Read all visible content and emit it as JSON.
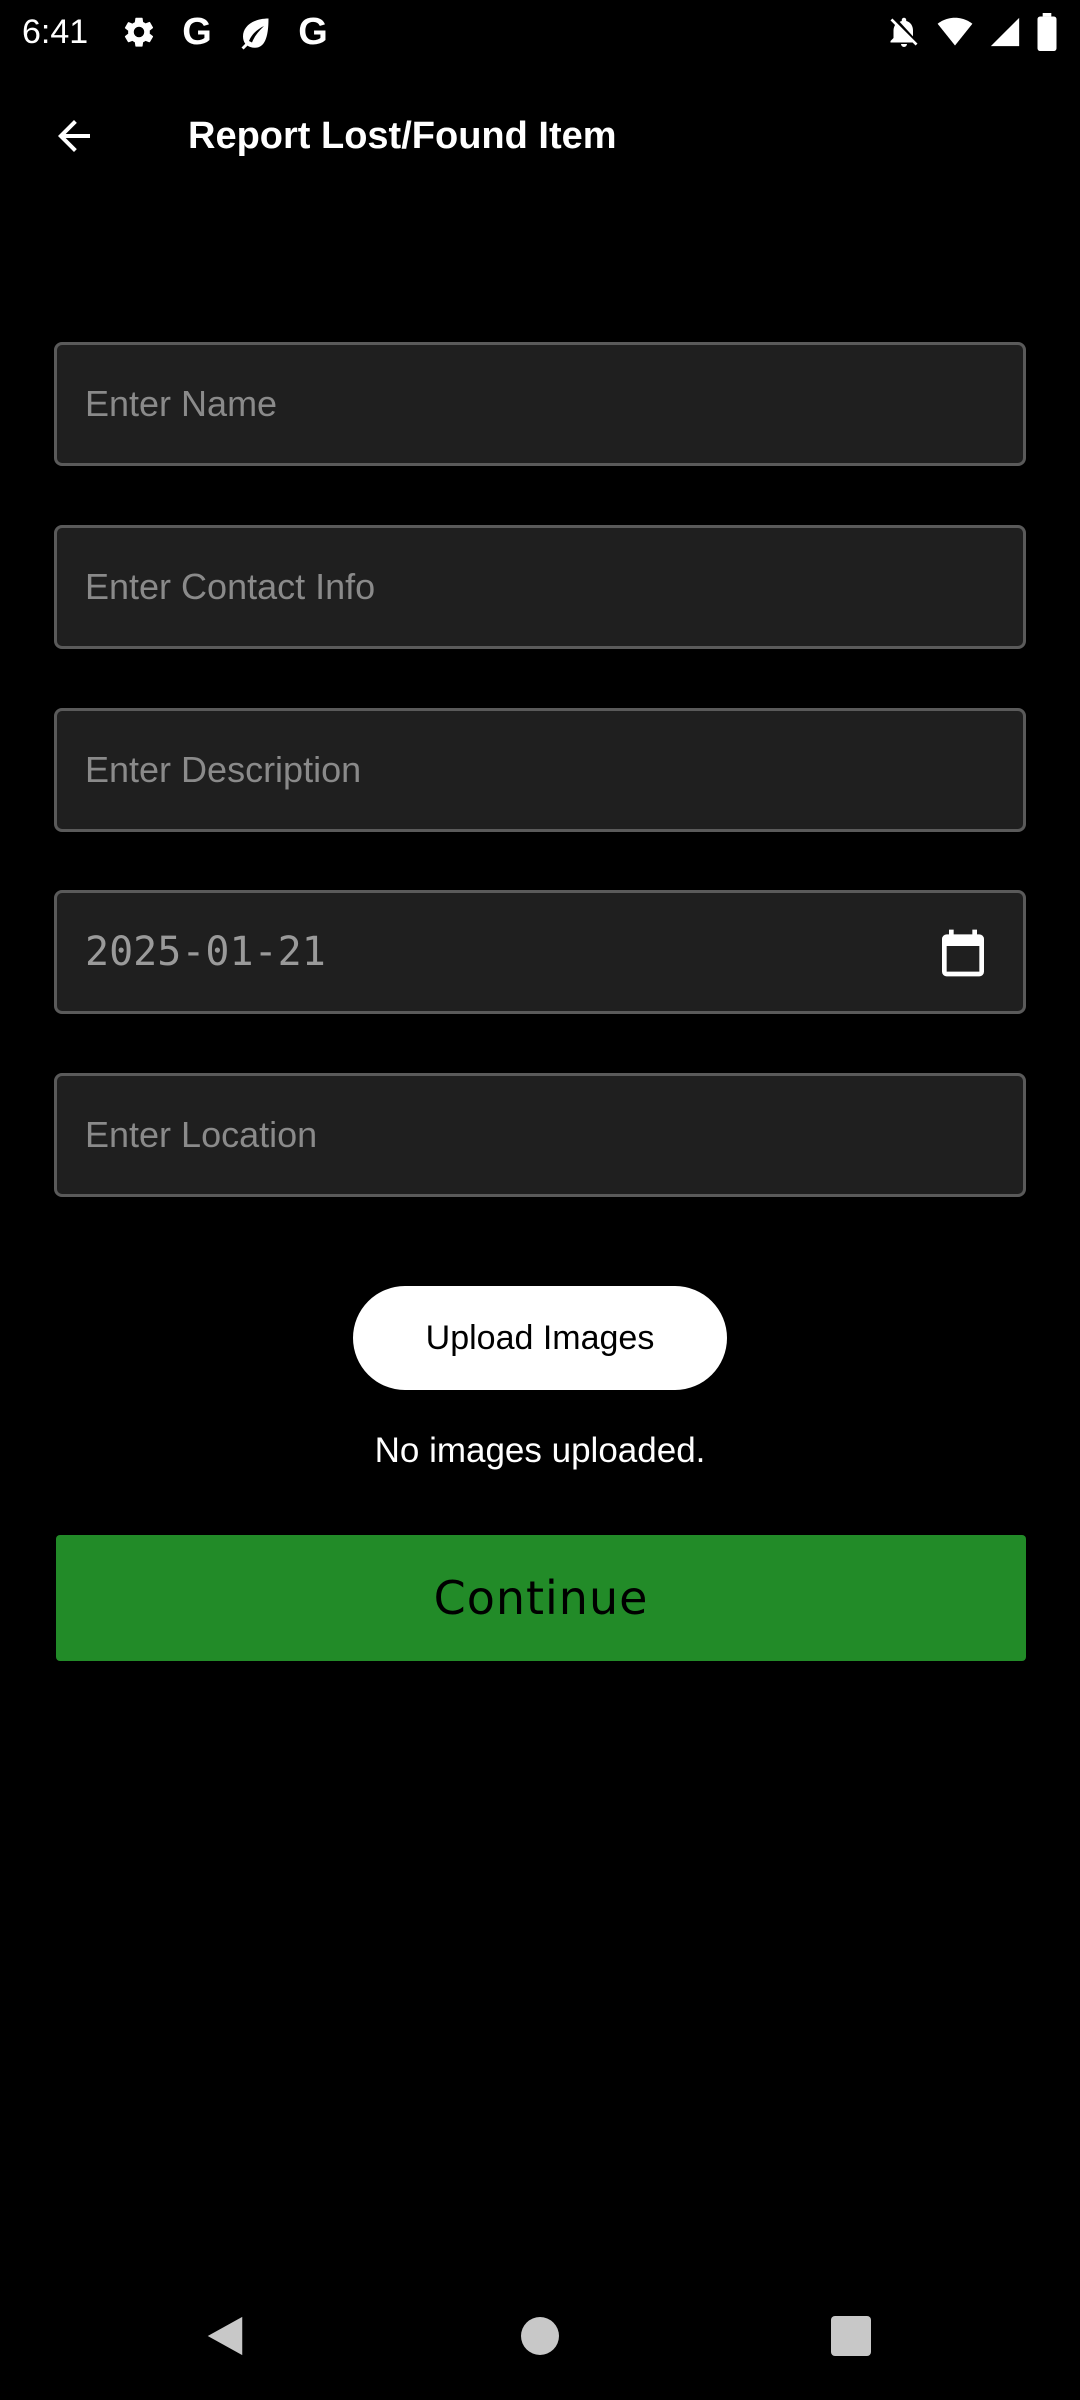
{
  "status_bar": {
    "time": "6:41",
    "left_icons": [
      "settings-icon",
      "google-icon",
      "leaf-icon",
      "google-icon"
    ],
    "right_icons": [
      "notifications-off-icon",
      "wifi-icon",
      "signal-icon",
      "battery-icon"
    ]
  },
  "app_bar": {
    "back_icon": "arrow-left-icon",
    "title": "Report Lost/Found Item"
  },
  "form": {
    "name": {
      "placeholder": "Enter Name",
      "value": ""
    },
    "contact": {
      "placeholder": "Enter Contact Info",
      "value": ""
    },
    "description": {
      "placeholder": "Enter Description",
      "value": ""
    },
    "date": {
      "value": "2025-01-21",
      "icon": "calendar-icon"
    },
    "location": {
      "placeholder": "Enter Location",
      "value": ""
    },
    "upload_label": "Upload Images",
    "upload_status": "No images uploaded.",
    "continue_label": "Continue"
  },
  "nav_bar": {
    "icons": [
      "back-triangle-icon",
      "home-circle-icon",
      "recents-square-icon"
    ]
  },
  "colors": {
    "background": "#000000",
    "field_background": "#1f1f1f",
    "field_border": "#5a5a5a",
    "continue_green": "#228b28",
    "upload_button": "#ffffff"
  }
}
